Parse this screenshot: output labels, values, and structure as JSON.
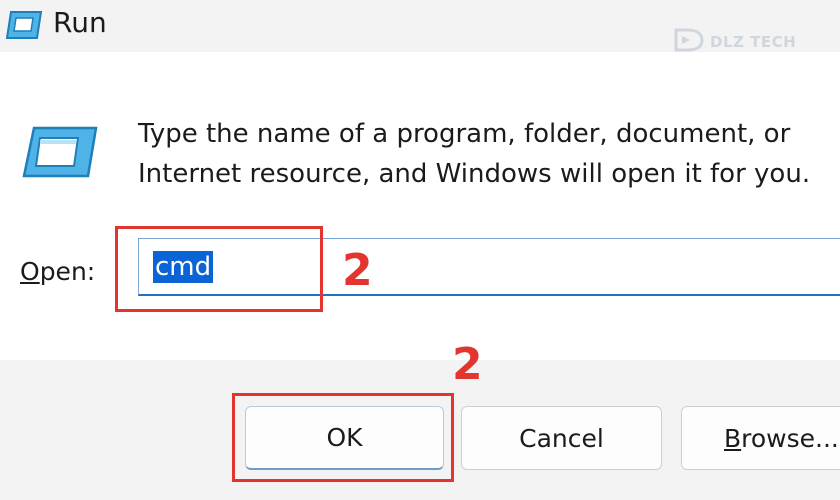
{
  "window": {
    "title": "Run",
    "watermark": "DLZ TECH"
  },
  "dialog": {
    "description_line1": "Type the name of a program, folder, document, or",
    "description_line2": "Internet resource, and Windows will open it for you.",
    "open_label_accel": "O",
    "open_label_rest": "pen:",
    "open_value": "cmd"
  },
  "annotations": {
    "step_input": "2",
    "step_ok": "2",
    "highlight_color": "#e2352f"
  },
  "buttons": {
    "ok_label": "OK",
    "cancel_label": "Cancel",
    "browse_accel": "B",
    "browse_rest": "rowse..."
  },
  "icons": {
    "app": "run-app-icon",
    "dialog": "run-dialog-icon",
    "watermark": "dlz-tech-logo"
  },
  "colors": {
    "selection": "#0a64d6",
    "input_focus_border": "#1a73c8"
  }
}
